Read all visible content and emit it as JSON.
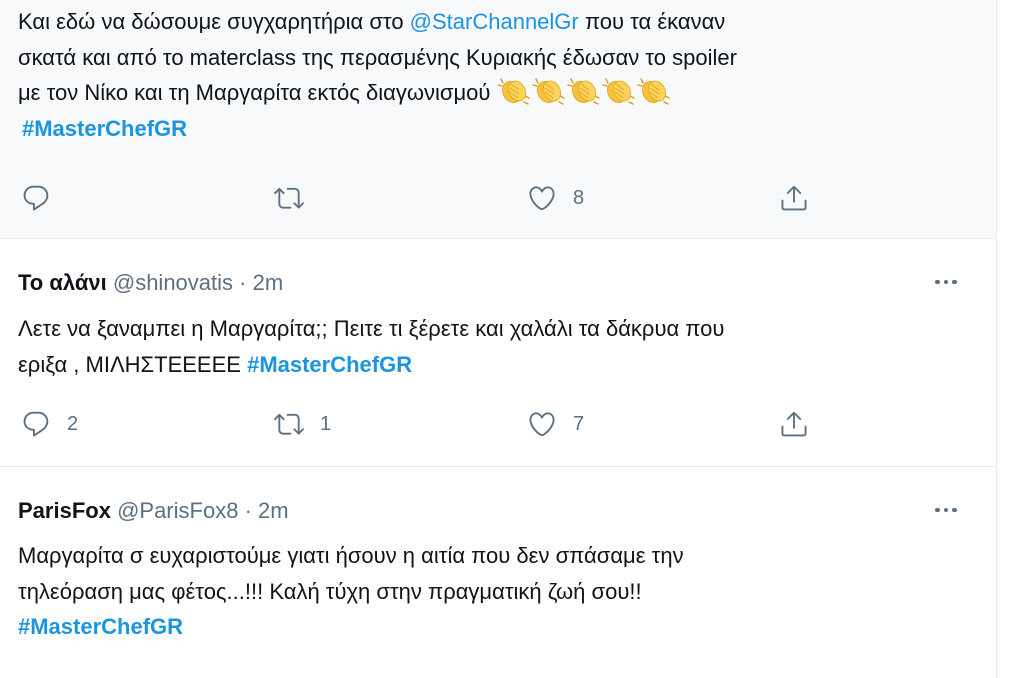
{
  "tweets": [
    {
      "lines": [
        {
          "pre": "Και εδώ να δώσουμε συγχαρητήρια στο ",
          "mention": "@StarChannelGr",
          "post": " που τα έκαναν"
        },
        {
          "text": "σκατά και από το materclass της περασμένης Κυριακής έδωσαν το spoiler"
        },
        {
          "text": "με τον Νίκο και τη Μαργαρίτα εκτός διαγωνισμού "
        }
      ],
      "emoji": "clapping-hands x5",
      "hashtag": "#MasterChefGR",
      "actions": {
        "reply": "",
        "retweet": "",
        "like": "8"
      }
    },
    {
      "display_name": "Το αλάνι",
      "handle": "@shinovatis",
      "separator": "·",
      "time": "2m",
      "lines": [
        {
          "text": "Λετε να ξαναμπει η Μαργαρίτα;; Πειτε τι ξέρετε και χαλάλι τα δάκρυα που"
        },
        {
          "pre": "εριξα , ΜΙΛΗΣΤΕΕΕΕΕ "
        }
      ],
      "hashtag": "#MasterChefGR",
      "actions": {
        "reply": "2",
        "retweet": "1",
        "like": "7"
      }
    },
    {
      "display_name": "ParisFox",
      "handle": "@ParisFox8",
      "separator": "·",
      "time": "2m",
      "lines": [
        {
          "text": "Μαργαρίτα σ ευχαριστούμε γιατι ήσουν η αιτία που δεν σπάσαμε την"
        },
        {
          "text": "τηλεόραση μας φέτος...!!! Καλή τύχη στην πραγματική ζωή σου!!"
        }
      ],
      "hashtag": "#MasterChefGR"
    }
  ],
  "icons": [
    "reply-icon",
    "retweet-icon",
    "like-icon",
    "share-icon",
    "more-icon",
    "clapping-hands-emoji"
  ],
  "colors": {
    "link": "#1b95e0",
    "secondary": "#5b7083",
    "divider": "#e6ecf0",
    "highlight_bg": "#f7f9fa"
  }
}
